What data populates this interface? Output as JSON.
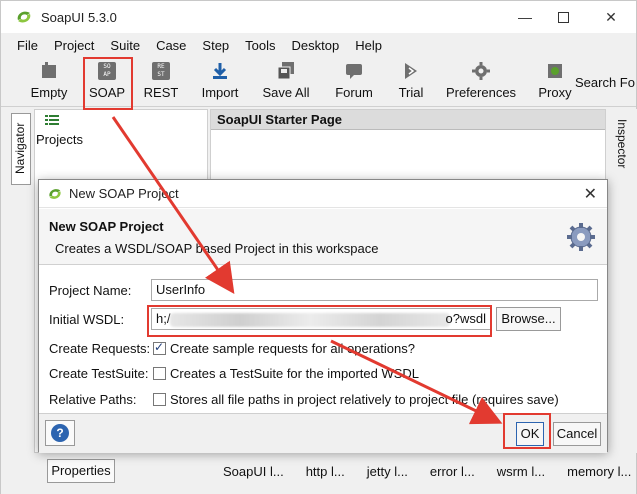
{
  "window": {
    "title": "SoapUI 5.3.0"
  },
  "menu": [
    "File",
    "Project",
    "Suite",
    "Case",
    "Step",
    "Tools",
    "Desktop",
    "Help"
  ],
  "toolbar": {
    "items": [
      {
        "label": "Empty",
        "icon": "empty-project-icon"
      },
      {
        "label": "SOAP",
        "icon": "soap-icon"
      },
      {
        "label": "REST",
        "icon": "rest-icon"
      },
      {
        "label": "Import",
        "icon": "import-icon"
      },
      {
        "label": "Save All",
        "icon": "save-all-icon"
      },
      {
        "label": "Forum",
        "icon": "forum-icon"
      },
      {
        "label": "Trial",
        "icon": "trial-icon"
      },
      {
        "label": "Preferences",
        "icon": "gear-icon"
      },
      {
        "label": "Proxy",
        "icon": "proxy-icon"
      }
    ],
    "search_label": "Search Fo",
    "soap_icon_text": "SO\nAP",
    "rest_icon_text": "RE\nST"
  },
  "navigator": {
    "tab_label": "Navigator",
    "projects_label": "Projects"
  },
  "inspector": {
    "tab_label": "Inspector"
  },
  "starter_page": {
    "title": "SoapUI Starter Page"
  },
  "bottom": {
    "properties_label": "Properties",
    "tabs": [
      "SoapUI l...",
      "http l...",
      "jetty l...",
      "error l...",
      "wsrm l...",
      "memory l..."
    ]
  },
  "dialog": {
    "title": "New SOAP Project",
    "heading": "New SOAP Project",
    "subheading": "Creates a WSDL/SOAP based Project in this workspace",
    "project_name_label": "Project Name:",
    "project_name_value": "UserInfo",
    "wsdl_label": "Initial WSDL:",
    "wsdl_value_start": "h;/",
    "wsdl_value_end": "o?wsdl",
    "browse_label": "Browse...",
    "create_requests_label": "Create Requests:",
    "create_requests_text": "Create sample requests for all operations?",
    "create_requests_checked": true,
    "create_testsuite_label": "Create TestSuite:",
    "create_testsuite_text": "Creates a TestSuite for the imported WSDL",
    "create_testsuite_checked": false,
    "relative_paths_label": "Relative Paths:",
    "relative_paths_text": "Stores all file paths in project relatively to project file (requires save)",
    "relative_paths_checked": false,
    "ok_label": "OK",
    "cancel_label": "Cancel",
    "help_label": "?"
  },
  "colors": {
    "highlight": "#e23a30",
    "accent": "#2c64b0",
    "logo_green": "#5aa02c"
  }
}
